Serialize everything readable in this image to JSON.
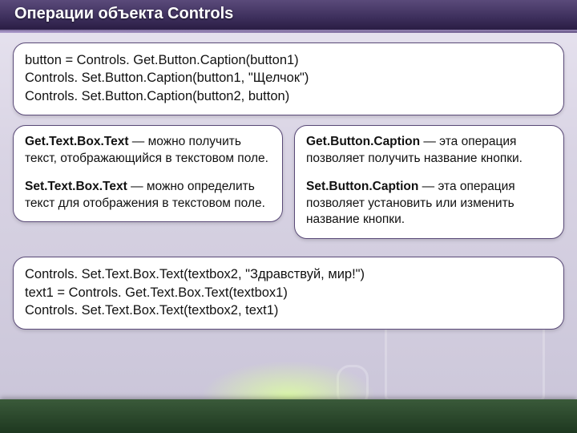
{
  "header": {
    "title": "Операции объекта Controls"
  },
  "codeTop": {
    "line1": "button = Controls. Get.Button.Caption(button1)",
    "line2": "Controls. Set.Button.Caption(button1, \"Щелчок\")",
    "line3": "Controls. Set.Button.Caption(button2, button)"
  },
  "leftBox": {
    "p1_bold": "Get.Text.Box.Text",
    "p1_rest": " — можно получить текст, отображающийся в текстовом поле.",
    "p2_bold": "Set.Text.Box.Text",
    "p2_rest": " — можно определить текст для отображения в текстовом поле."
  },
  "rightBox": {
    "p1_bold": "Get.Button.Caption",
    "p1_rest": " — эта операция позволяет получить название кнопки.",
    "p2_bold": "Set.Button.Caption",
    "p2_rest": " — эта операция позволяет установить или изменить название кнопки."
  },
  "codeBottom": {
    "line1": "Controls. Set.Text.Box.Text(textbox2, \"Здравствуй, мир!\")",
    "line2": "text1 = Controls. Get.Text.Box.Text(textbox1)",
    "line3": "Controls. Set.Text.Box.Text(textbox2, text1)"
  }
}
